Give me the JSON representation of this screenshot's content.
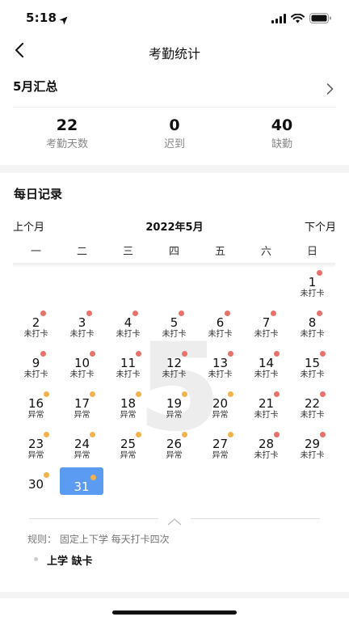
{
  "status_bar": {
    "time": "5:18",
    "icons": [
      "location-arrow-icon",
      "signal-icon",
      "wifi-icon",
      "battery-icon"
    ]
  },
  "nav": {
    "title": "考勤统计",
    "back_icon": "chevron-left-icon"
  },
  "summary": {
    "title": "5月汇总",
    "chevron_icon": "chevron-right-icon",
    "stats": [
      {
        "value": "22",
        "label": "考勤天数"
      },
      {
        "value": "0",
        "label": "迟到"
      },
      {
        "value": "40",
        "label": "缺勤"
      }
    ]
  },
  "daily": {
    "title": "每日记录",
    "prev_label": "上个月",
    "current_month": "2022年5月",
    "next_label": "下个月",
    "weekdays": [
      "一",
      "二",
      "三",
      "四",
      "五",
      "六",
      "日"
    ],
    "watermark": "5"
  },
  "colors": {
    "absent_dot": "#e8726b",
    "abnormal_dot": "#f2b24c",
    "selected_bg": "#5b9cf2"
  },
  "calendar": {
    "first_weekday_index": 6,
    "selected_day": 31,
    "days": [
      {
        "day": "1",
        "status": "未打卡",
        "dot": "absent"
      },
      {
        "day": "2",
        "status": "未打卡",
        "dot": "absent"
      },
      {
        "day": "3",
        "status": "未打卡",
        "dot": "absent"
      },
      {
        "day": "4",
        "status": "未打卡",
        "dot": "absent"
      },
      {
        "day": "5",
        "status": "未打卡",
        "dot": "absent"
      },
      {
        "day": "6",
        "status": "未打卡",
        "dot": "absent"
      },
      {
        "day": "7",
        "status": "未打卡",
        "dot": "absent"
      },
      {
        "day": "8",
        "status": "未打卡",
        "dot": "absent"
      },
      {
        "day": "9",
        "status": "未打卡",
        "dot": "absent"
      },
      {
        "day": "10",
        "status": "未打卡",
        "dot": "absent"
      },
      {
        "day": "11",
        "status": "未打卡",
        "dot": "absent"
      },
      {
        "day": "12",
        "status": "未打卡",
        "dot": "absent"
      },
      {
        "day": "13",
        "status": "未打卡",
        "dot": "absent"
      },
      {
        "day": "14",
        "status": "未打卡",
        "dot": "absent"
      },
      {
        "day": "15",
        "status": "未打卡",
        "dot": "absent"
      },
      {
        "day": "16",
        "status": "异常",
        "dot": "abnormal"
      },
      {
        "day": "17",
        "status": "异常",
        "dot": "abnormal"
      },
      {
        "day": "18",
        "status": "异常",
        "dot": "abnormal"
      },
      {
        "day": "19",
        "status": "异常",
        "dot": "abnormal"
      },
      {
        "day": "20",
        "status": "异常",
        "dot": "abnormal"
      },
      {
        "day": "21",
        "status": "未打卡",
        "dot": "absent"
      },
      {
        "day": "22",
        "status": "未打卡",
        "dot": "absent"
      },
      {
        "day": "23",
        "status": "异常",
        "dot": "abnormal"
      },
      {
        "day": "24",
        "status": "异常",
        "dot": "abnormal"
      },
      {
        "day": "25",
        "status": "异常",
        "dot": "abnormal"
      },
      {
        "day": "26",
        "status": "异常",
        "dot": "abnormal"
      },
      {
        "day": "27",
        "status": "异常",
        "dot": "abnormal"
      },
      {
        "day": "28",
        "status": "未打卡",
        "dot": "absent"
      },
      {
        "day": "29",
        "status": "未打卡",
        "dot": "absent"
      },
      {
        "day": "30",
        "status": "",
        "dot": "abnormal"
      },
      {
        "day": "31",
        "status": "",
        "dot": "abnormal"
      }
    ]
  },
  "rule": {
    "text": "规则： 固定上下学 每天打卡四次",
    "collapse_icon": "chevron-up-icon"
  },
  "record": {
    "text": "上学 缺卡"
  }
}
